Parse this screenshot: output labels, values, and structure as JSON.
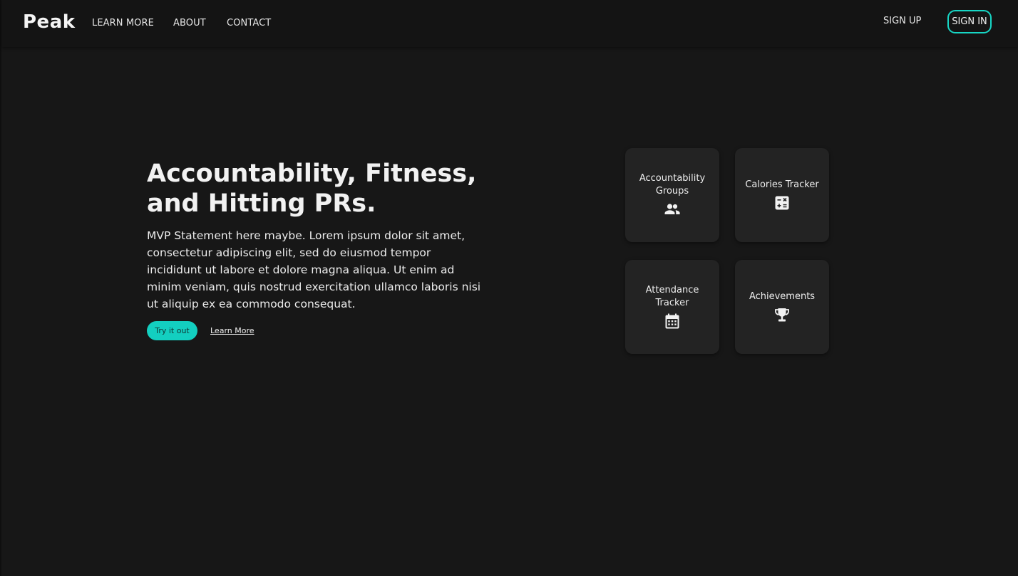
{
  "nav": {
    "brand": "Peak",
    "links": [
      "LEARN MORE",
      "ABOUT",
      "CONTACT"
    ],
    "sign_up": "SIGN UP",
    "sign_in": "SIGN IN"
  },
  "hero": {
    "title": "Accountability, Fitness,\nand Hitting PRs.",
    "description": "MVP Statement here maybe. Lorem ipsum dolor sit amet, consectetur adipiscing elit, sed do eiusmod tempor incididunt ut labore et dolore magna aliqua. Ut enim ad minim veniam, quis nostrud exercitation ullamco laboris nisi ut aliquip ex ea commodo consequat.",
    "primary_button": "Try it out",
    "secondary_link": "Learn More"
  },
  "features": [
    {
      "label": "Accountability\nGroups",
      "icon": "group-icon"
    },
    {
      "label": "Calories Tracker",
      "icon": "calculator-icon"
    },
    {
      "label": "Attendance\nTracker",
      "icon": "calendar-icon"
    },
    {
      "label": "Achievements",
      "icon": "trophy-icon"
    }
  ],
  "colors": {
    "background": "#171717",
    "navbar": "#141414",
    "card": "#232323",
    "accent": "#13cfc0",
    "sign_in_border": "#17d6c5",
    "text": "#f2f2f2"
  }
}
